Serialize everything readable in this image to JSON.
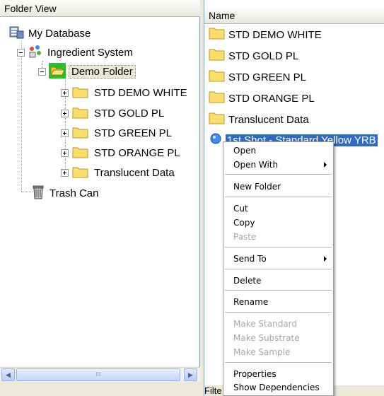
{
  "left_pane": {
    "header": "Folder View",
    "tree": {
      "root": {
        "label": "My Database",
        "icon": "database-icon"
      },
      "system": {
        "label": "Ingredient System",
        "icon": "ingredient-system-icon"
      },
      "demo_folder": {
        "label": "Demo Folder",
        "icon": "open-folder-icon"
      },
      "children": [
        {
          "label": "STD DEMO WHITE",
          "icon": "folder-icon"
        },
        {
          "label": "STD GOLD PL",
          "icon": "folder-icon"
        },
        {
          "label": "STD GREEN PL",
          "icon": "folder-icon"
        },
        {
          "label": "STD ORANGE PL",
          "icon": "folder-icon"
        },
        {
          "label": "Translucent Data",
          "icon": "folder-icon"
        }
      ],
      "trash": {
        "label": "Trash Can",
        "icon": "trash-can-icon"
      }
    },
    "scrollbar_grip": "III"
  },
  "right_pane": {
    "header": "Name",
    "items": [
      {
        "label": "STD DEMO WHITE",
        "icon": "folder-icon"
      },
      {
        "label": "STD GOLD PL",
        "icon": "folder-icon"
      },
      {
        "label": "STD GREEN PL",
        "icon": "folder-icon"
      },
      {
        "label": "STD ORANGE PL",
        "icon": "folder-icon"
      },
      {
        "label": "Translucent Data",
        "icon": "folder-icon"
      },
      {
        "label": "1st Shot - Standard Yellow YRB",
        "icon": "sample-icon"
      }
    ],
    "bottom_label": "Filte"
  },
  "context_menu": {
    "open": "Open",
    "open_with": "Open With",
    "new_folder": "New Folder",
    "cut": "Cut",
    "copy": "Copy",
    "paste": "Paste",
    "send_to": "Send To",
    "delete": "Delete",
    "rename": "Rename",
    "make_standard": "Make Standard",
    "make_substrate": "Make Substrate",
    "make_sample": "Make Sample",
    "properties": "Properties",
    "show_dependencies": "Show Dependencies"
  },
  "colors": {
    "selection": "#316ac5",
    "folder_yellow": "#fcdc6a",
    "disabled_text": "#a7a6aa"
  }
}
